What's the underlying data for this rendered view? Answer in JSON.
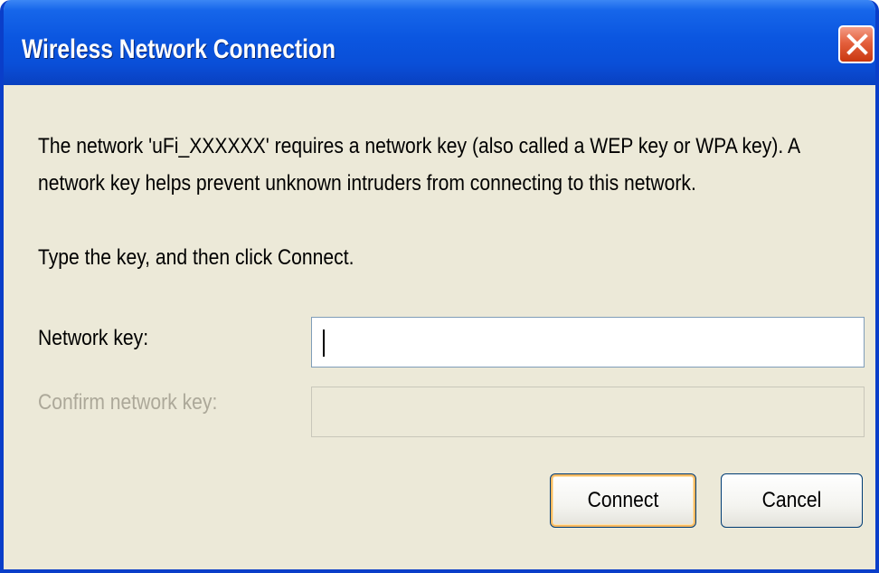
{
  "window": {
    "title": "Wireless Network Connection"
  },
  "message": {
    "line1": "The network 'uFi_XXXXXX' requires a network key (also called a WEP key or WPA key). A",
    "line2": "network key helps prevent unknown intruders from connecting to this network.",
    "instruction": "Type the key, and then click Connect."
  },
  "fields": {
    "network_key_label": "Network key:",
    "network_key_value": "",
    "confirm_key_label": "Confirm network key:",
    "confirm_key_value": ""
  },
  "buttons": {
    "connect_label": "Connect",
    "cancel_label": "Cancel"
  },
  "icons": {
    "close": "close-icon"
  },
  "colors": {
    "titlebar": "#0a56e0",
    "body": "#ece9d8",
    "close_button": "#d9532c",
    "disabled_text": "#aca899"
  }
}
